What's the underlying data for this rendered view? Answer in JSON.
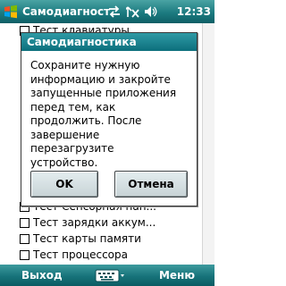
{
  "status_bar": {
    "app_title": "Самодиагност",
    "clock": "12:33",
    "icons": [
      "windows-start-icon",
      "connectivity-icon",
      "signal-off-icon",
      "volume-icon"
    ]
  },
  "background_list": {
    "items": [
      {
        "label": "Тест клавиатуры",
        "checked": false
      },
      {
        "label": "Тест Сенсорная пан...",
        "checked": false
      },
      {
        "label": "Тест зарядки аккум...",
        "checked": false
      },
      {
        "label": "Тест карты памяти",
        "checked": false
      },
      {
        "label": "Тест процессора",
        "checked": false
      }
    ]
  },
  "dialog": {
    "title": "Самодиагностика",
    "message": "Сохраните нужную\nинформацию и закройте\nзапущенные приложения\nперед тем, как\nпродолжить. После\nзавершение\nперезагрузите\nустройство.",
    "ok_label": "OK",
    "cancel_label": "Отмена"
  },
  "softkeys": {
    "left": "Выход",
    "right": "Меню"
  },
  "colors": {
    "titlebar": "#1c7b80",
    "dialog_title": "#0c6f7c",
    "softkeybar": "#17737a"
  }
}
